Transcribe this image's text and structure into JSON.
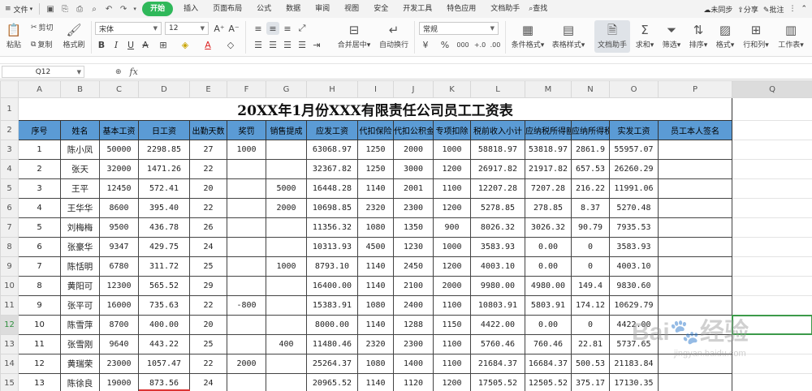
{
  "menubar": {
    "file": "文件",
    "tabs": [
      "开始",
      "插入",
      "页面布局",
      "公式",
      "数据",
      "审阅",
      "视图",
      "安全",
      "开发工具",
      "特色应用",
      "文档助手"
    ],
    "search": "查找",
    "sync": "未同步",
    "share": "分享",
    "annotate": "批注"
  },
  "ribbon": {
    "paste": "粘贴",
    "cut": "剪切",
    "copy": "复制",
    "format_painter": "格式刷",
    "font_name": "宋体",
    "font_size": "12",
    "merge": "合并居中",
    "wrap": "自动换行",
    "number_format": "常规",
    "cond_format": "条件格式",
    "table_style": "表格样式",
    "doc_helper": "文档助手",
    "sum": "求和",
    "filter": "筛选",
    "sort": "排序",
    "format": "格式",
    "rowcol": "行和列",
    "worksheet": "工作表",
    "percent": "%",
    "thousands": "000",
    "dec_inc": "+.0",
    "dec_dec": ".00"
  },
  "formula_bar": {
    "cell_ref": "Q12",
    "fx": "fx",
    "formula": ""
  },
  "columns": [
    "A",
    "B",
    "C",
    "D",
    "E",
    "F",
    "G",
    "H",
    "I",
    "J",
    "K",
    "L",
    "M",
    "N",
    "O",
    "P",
    "Q"
  ],
  "row_numbers": [
    "1",
    "2",
    "3",
    "4",
    "5",
    "6",
    "7",
    "8",
    "9",
    "10",
    "11",
    "12",
    "13",
    "14",
    "15"
  ],
  "title": "20XX年1月份XXX有限责任公司员工工资表",
  "headers": [
    "序号",
    "姓名",
    "基本工资",
    "日工资",
    "出勤天数",
    "奖罚",
    "销售提成",
    "应发工资",
    "代扣保险",
    "代扣公积金",
    "专项扣除",
    "税前收入小计",
    "应纳税所得额",
    "应纳所得税",
    "实发工资",
    "员工本人签名"
  ],
  "rows": [
    [
      "1",
      "陈小凤",
      "50000",
      "2298.85",
      "27",
      "1000",
      "",
      "63068.97",
      "1250",
      "2000",
      "1000",
      "58818.97",
      "53818.97",
      "2861.9",
      "55957.07",
      ""
    ],
    [
      "2",
      "张天",
      "32000",
      "1471.26",
      "22",
      "",
      "",
      "32367.82",
      "1250",
      "3000",
      "1200",
      "26917.82",
      "21917.82",
      "657.53",
      "26260.29",
      ""
    ],
    [
      "3",
      "王平",
      "12450",
      "572.41",
      "20",
      "",
      "5000",
      "16448.28",
      "1140",
      "2001",
      "1100",
      "12207.28",
      "7207.28",
      "216.22",
      "11991.06",
      ""
    ],
    [
      "4",
      "王华华",
      "8600",
      "395.40",
      "22",
      "",
      "2000",
      "10698.85",
      "2320",
      "2300",
      "1200",
      "5278.85",
      "278.85",
      "8.37",
      "5270.48",
      ""
    ],
    [
      "5",
      "刘梅梅",
      "9500",
      "436.78",
      "26",
      "",
      "",
      "11356.32",
      "1080",
      "1350",
      "900",
      "8026.32",
      "3026.32",
      "90.79",
      "7935.53",
      ""
    ],
    [
      "6",
      "张豪华",
      "9347",
      "429.75",
      "24",
      "",
      "",
      "10313.93",
      "4500",
      "1230",
      "1000",
      "3583.93",
      "0.00",
      "0",
      "3583.93",
      ""
    ],
    [
      "7",
      "陈恬明",
      "6780",
      "311.72",
      "25",
      "",
      "1000",
      "8793.10",
      "1140",
      "2450",
      "1200",
      "4003.10",
      "0.00",
      "0",
      "4003.10",
      ""
    ],
    [
      "8",
      "黄阳可",
      "12300",
      "565.52",
      "29",
      "",
      "",
      "16400.00",
      "1140",
      "2100",
      "2000",
      "9980.00",
      "4980.00",
      "149.4",
      "9830.60",
      ""
    ],
    [
      "9",
      "张平可",
      "16000",
      "735.63",
      "22",
      "-800",
      "",
      "15383.91",
      "1080",
      "2400",
      "1100",
      "10803.91",
      "5803.91",
      "174.12",
      "10629.79",
      ""
    ],
    [
      "10",
      "陈雪萍",
      "8700",
      "400.00",
      "20",
      "",
      "",
      "8000.00",
      "1140",
      "1288",
      "1150",
      "4422.00",
      "0.00",
      "0",
      "4422.00",
      ""
    ],
    [
      "11",
      "张雪刚",
      "9640",
      "443.22",
      "25",
      "",
      "400",
      "11480.46",
      "2320",
      "2300",
      "1100",
      "5760.46",
      "760.46",
      "22.81",
      "5737.65",
      ""
    ],
    [
      "12",
      "黄瑞荣",
      "23000",
      "1057.47",
      "22",
      "2000",
      "",
      "25264.37",
      "1080",
      "1400",
      "1100",
      "21684.37",
      "16684.37",
      "500.53",
      "21183.84",
      ""
    ],
    [
      "13",
      "陈徐良",
      "19000",
      "873.56",
      "24",
      "",
      "",
      "20965.52",
      "1140",
      "1120",
      "1200",
      "17505.52",
      "12505.52",
      "375.17",
      "17130.35",
      ""
    ]
  ],
  "watermark": {
    "text": "Bai🐾经验",
    "url": "jingyan.baidu.com"
  },
  "colors": {
    "accent_green": "#2fb85a",
    "header_blue": "#5b9bd5",
    "selection_green": "#3c9a4a"
  }
}
